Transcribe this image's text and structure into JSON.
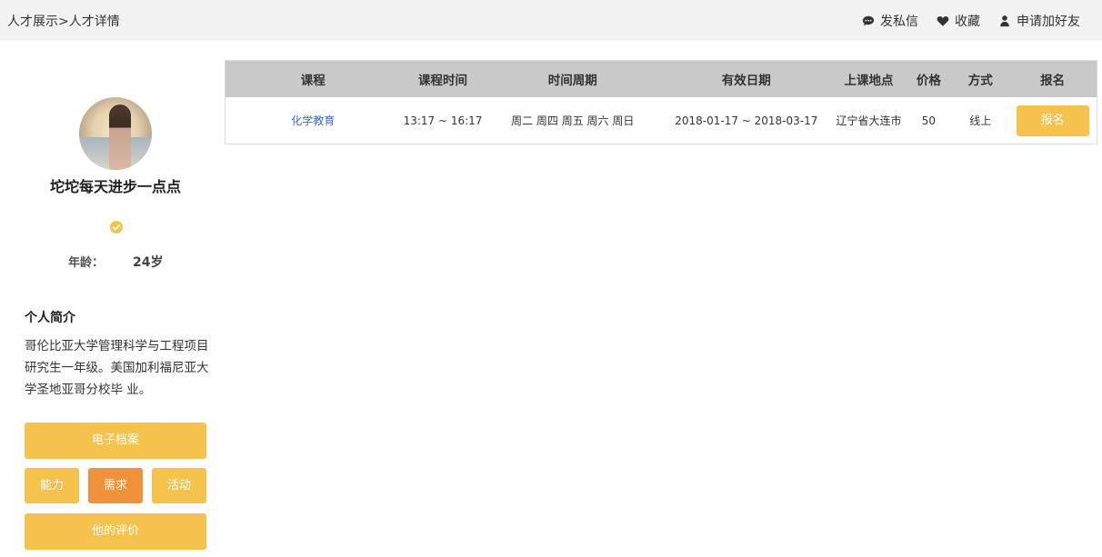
{
  "breadcrumb": "人才展示>人才详情",
  "top_actions": {
    "message": "发私信",
    "favorite": "收藏",
    "add_friend": "申请加好友"
  },
  "profile": {
    "username": "坨坨每天进步一点点",
    "age_label": "年龄：",
    "age_value": "24岁",
    "intro_title": "个人简介",
    "intro_text": "哥伦比亚大学管理科学与工程项目研究生一年级。美国加利福尼亚大学圣地亚哥分校毕 业。"
  },
  "buttons": {
    "archive": "电子档案",
    "ability": "能力",
    "demand": "需求",
    "activity": "活动",
    "review": "他的评价"
  },
  "table": {
    "headers": [
      "课程",
      "课程时间",
      "时间周期",
      "有效日期",
      "上课地点",
      "价格",
      "方式",
      "报名"
    ],
    "rows": [
      {
        "course": "化学教育",
        "time": "13:17 ~ 16:17",
        "period": "周二 周四 周五 周六 周日",
        "valid": "2018-01-17 ~ 2018-03-17",
        "location": "辽宁省大连市",
        "price": "50",
        "mode": "线上",
        "signup": "报名"
      }
    ]
  },
  "colors": {
    "accent": "#f5c34b",
    "active": "#f0913b",
    "link": "#3d6ea8",
    "header_bg": "#c9c9c9",
    "topbar_bg": "#f2f2f2"
  }
}
